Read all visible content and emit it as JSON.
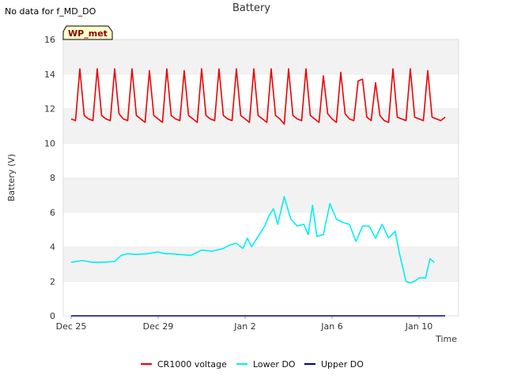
{
  "status_text": "No data for f_MD_DO",
  "site_badge": "WP_met",
  "chart_data": {
    "type": "line",
    "title": "Battery",
    "xlabel": "Time",
    "ylabel": "Battery (V)",
    "ylim": [
      0,
      16
    ],
    "yticks": [
      0,
      2,
      4,
      6,
      8,
      10,
      12,
      14,
      16
    ],
    "xlim": [
      0,
      16.5
    ],
    "xticks": [
      {
        "x": 0,
        "label": "Dec 25"
      },
      {
        "x": 4,
        "label": "Dec 29"
      },
      {
        "x": 8,
        "label": "Jan 2"
      },
      {
        "x": 12,
        "label": "Jan 6"
      },
      {
        "x": 16,
        "label": "Jan 10"
      }
    ],
    "x_unit": "days from Dec 25",
    "grid": "horizontal bands",
    "legend_position": "bottom",
    "series": [
      {
        "name": "CR1000 voltage",
        "color": "#ee0000",
        "x": [
          0.0,
          0.2,
          0.4,
          0.6,
          0.8,
          1.0,
          1.2,
          1.4,
          1.6,
          1.8,
          2.0,
          2.2,
          2.4,
          2.6,
          2.8,
          3.0,
          3.2,
          3.4,
          3.6,
          3.8,
          4.0,
          4.2,
          4.4,
          4.6,
          4.8,
          5.0,
          5.2,
          5.4,
          5.6,
          5.8,
          6.0,
          6.2,
          6.4,
          6.6,
          6.8,
          7.0,
          7.2,
          7.4,
          7.6,
          7.8,
          8.0,
          8.2,
          8.4,
          8.6,
          8.8,
          9.0,
          9.2,
          9.4,
          9.6,
          9.8,
          10.0,
          10.2,
          10.4,
          10.6,
          10.8,
          11.0,
          11.2,
          11.4,
          11.6,
          11.8,
          12.0,
          12.2,
          12.4,
          12.6,
          12.8,
          13.0,
          13.2,
          13.4,
          13.6,
          13.8,
          14.0,
          14.2,
          14.4,
          14.6,
          14.8,
          15.0,
          15.2,
          15.4,
          15.6,
          15.8,
          16.0,
          16.2,
          16.4,
          16.6,
          16.8,
          17.0,
          17.2
        ],
        "y": [
          11.4,
          11.3,
          14.3,
          11.6,
          11.4,
          11.3,
          14.3,
          11.6,
          11.4,
          11.3,
          14.3,
          11.7,
          11.4,
          11.3,
          14.3,
          11.6,
          11.4,
          11.2,
          14.2,
          11.6,
          11.4,
          11.2,
          14.3,
          11.6,
          11.4,
          11.3,
          14.2,
          11.6,
          11.4,
          11.2,
          14.3,
          11.6,
          11.4,
          11.3,
          14.3,
          11.6,
          11.4,
          11.3,
          14.3,
          11.6,
          11.4,
          11.2,
          14.3,
          11.6,
          11.4,
          11.2,
          14.3,
          11.6,
          11.4,
          11.1,
          14.3,
          11.6,
          11.4,
          11.3,
          14.3,
          11.6,
          11.4,
          11.2,
          13.9,
          11.7,
          11.4,
          11.2,
          14.1,
          11.7,
          11.4,
          11.3,
          13.6,
          13.7,
          11.5,
          11.3,
          13.5,
          11.6,
          11.3,
          11.2,
          14.3,
          11.5,
          11.4,
          11.3,
          14.3,
          11.5,
          11.4,
          11.3,
          14.2,
          11.5,
          11.4,
          11.3,
          11.5
        ]
      },
      {
        "name": "Lower DO",
        "color": "#00f0f0",
        "x": [
          0.0,
          0.5,
          1.0,
          1.5,
          2.0,
          2.3,
          2.6,
          3.0,
          3.5,
          4.0,
          4.3,
          4.6,
          5.0,
          5.5,
          6.0,
          6.5,
          7.0,
          7.3,
          7.6,
          7.9,
          8.1,
          8.3,
          8.6,
          8.9,
          9.1,
          9.3,
          9.5,
          9.8,
          10.1,
          10.4,
          10.7,
          10.9,
          11.1,
          11.3,
          11.6,
          11.9,
          12.2,
          12.5,
          12.8,
          13.1,
          13.4,
          13.7,
          14.0,
          14.3,
          14.6,
          14.9,
          15.1,
          15.4,
          15.6,
          15.8,
          16.0,
          16.3,
          16.5,
          16.7
        ],
        "y": [
          3.1,
          3.2,
          3.1,
          3.1,
          3.15,
          3.5,
          3.6,
          3.55,
          3.6,
          3.7,
          3.6,
          3.6,
          3.55,
          3.5,
          3.8,
          3.75,
          3.9,
          4.1,
          4.2,
          3.9,
          4.5,
          4.0,
          4.6,
          5.2,
          5.8,
          6.2,
          5.3,
          6.9,
          5.6,
          5.2,
          5.3,
          4.7,
          6.4,
          4.6,
          4.7,
          6.5,
          5.6,
          5.4,
          5.3,
          4.3,
          5.2,
          5.2,
          4.5,
          5.3,
          4.5,
          4.9,
          3.6,
          2.0,
          1.9,
          2.0,
          2.2,
          2.2,
          3.3,
          3.1
        ]
      },
      {
        "name": "Upper DO",
        "color": "#00008b",
        "x": [
          0.0,
          17.2
        ],
        "y": [
          0.0,
          0.0
        ]
      }
    ]
  }
}
